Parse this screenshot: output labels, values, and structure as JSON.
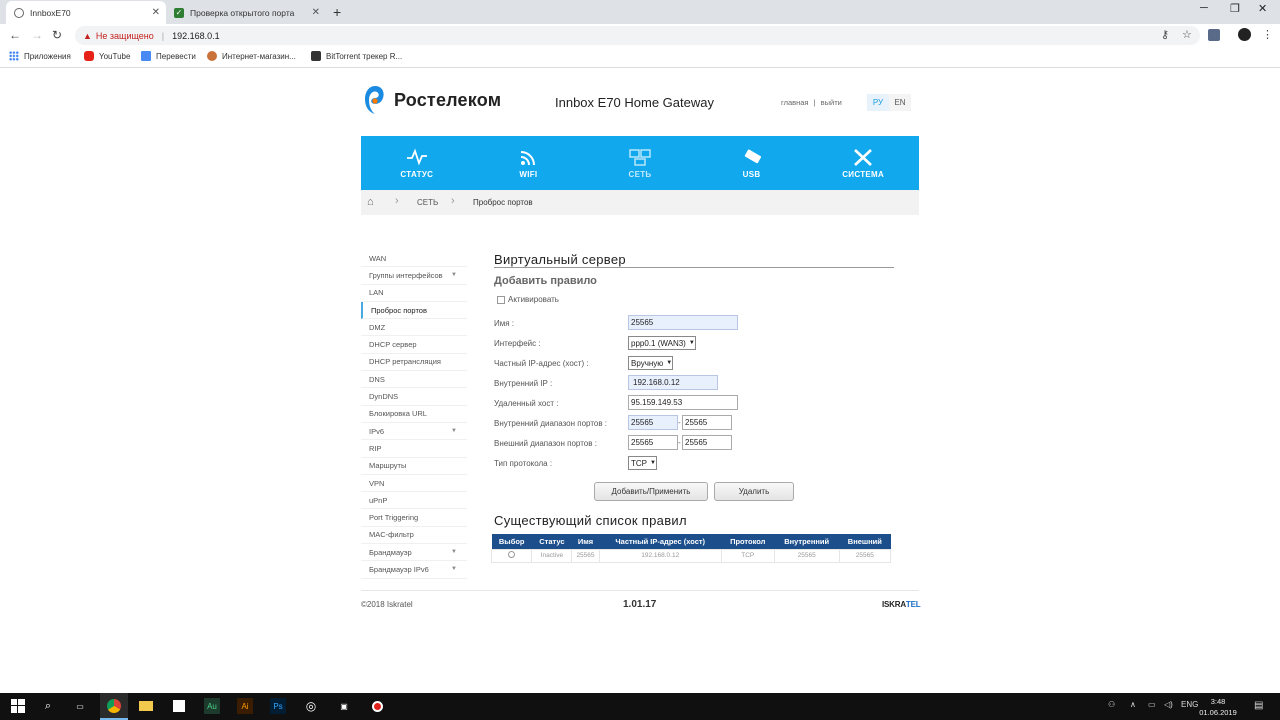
{
  "browser": {
    "tabs": [
      {
        "title": "InnboxE70"
      },
      {
        "title": "Проверка открытого порта"
      }
    ],
    "security_label": "Не защищено",
    "url": "192.168.0.1",
    "bookmarks": [
      "Приложения",
      "YouTube",
      "Перевести",
      "Интернет-магазин...",
      "BitTorrent трекер R..."
    ]
  },
  "header": {
    "brand": "Ростелеком",
    "product": "Innbox E70 Home Gateway",
    "link_home": "главная",
    "link_sep": "|",
    "link_logout": "выйти",
    "lang_ru": "РУ",
    "lang_en": "EN"
  },
  "nav": [
    {
      "label": "СТАТУС",
      "icon": "pulse-icon"
    },
    {
      "label": "WIFI",
      "icon": "wifi-icon"
    },
    {
      "label": "СЕТЬ",
      "icon": "network-icon"
    },
    {
      "label": "USB",
      "icon": "usb-icon"
    },
    {
      "label": "СИСТЕМА",
      "icon": "tools-icon"
    }
  ],
  "breadcrumb": {
    "section": "СЕТЬ",
    "page": "Проброс портов"
  },
  "sidebar": [
    {
      "label": "WAN"
    },
    {
      "label": "Группы интерфейсов",
      "caret": "▼"
    },
    {
      "label": "LAN"
    },
    {
      "label": "Проброс портов"
    },
    {
      "label": "DMZ"
    },
    {
      "label": "DHCP сервер"
    },
    {
      "label": "DHCP ретрансляция"
    },
    {
      "label": "DNS"
    },
    {
      "label": "DynDNS"
    },
    {
      "label": "Блокировка URL"
    },
    {
      "label": "IPv6",
      "caret": "▼"
    },
    {
      "label": "RIP"
    },
    {
      "label": "Маршруты"
    },
    {
      "label": "VPN"
    },
    {
      "label": "uPnP"
    },
    {
      "label": "Port Triggering"
    },
    {
      "label": "MAC-фильтр"
    },
    {
      "label": "Брандмауэр",
      "caret": "▼"
    },
    {
      "label": "Брандмауэр IPv6",
      "caret": "▼"
    }
  ],
  "form": {
    "title": "Виртуальный сервер",
    "subtitle": "Добавить правило",
    "activate_label": "Активировать",
    "name_label": "Имя :",
    "name_value": "25565",
    "interface_label": "Интерфейс :",
    "interface_value": "ppp0.1 (WAN3)",
    "private_ip_label": "Частный IP-адрес (хост) :",
    "private_ip_value": "Вручную",
    "internal_ip_label": "Внутренний IP :",
    "internal_ip_value": "192.168.0.12",
    "remote_host_label": "Удаленный хост :",
    "remote_host_value": "95.159.149.53",
    "internal_range_label": "Внутренний диапазон портов :",
    "internal_range_from": "25565",
    "internal_range_to": "25565",
    "external_range_label": "Внешний диапазон портов :",
    "external_range_from": "25565",
    "external_range_to": "25565",
    "protocol_label": "Тип протокола :",
    "protocol_value": "TCP",
    "range_sep": "-",
    "apply_button": "Добавить/Применить",
    "delete_button": "Удалить"
  },
  "rules": {
    "title": "Существующий список правил",
    "columns": [
      "Выбор",
      "Статус",
      "Имя",
      "Частный IP-адрес (хост)",
      "Протокол",
      "Внутренний",
      "Внешний"
    ],
    "rows": [
      {
        "status": "Inactive",
        "name": "25565",
        "ip": "192.168.0.12",
        "protocol": "TCP",
        "internal": "25565",
        "external": "25565"
      }
    ]
  },
  "footer": {
    "copyright": "©2018 Iskratel",
    "version": "1.01.17",
    "logo_a": "ISKRA",
    "logo_b": "TEL"
  },
  "taskbar": {
    "lang": "ENG",
    "time": "3:48",
    "date": "01.06.2019"
  },
  "colors": {
    "nav_blue": "#12a8ee",
    "table_header": "#1c4e8c",
    "brand_orange": "#ff7a00"
  }
}
